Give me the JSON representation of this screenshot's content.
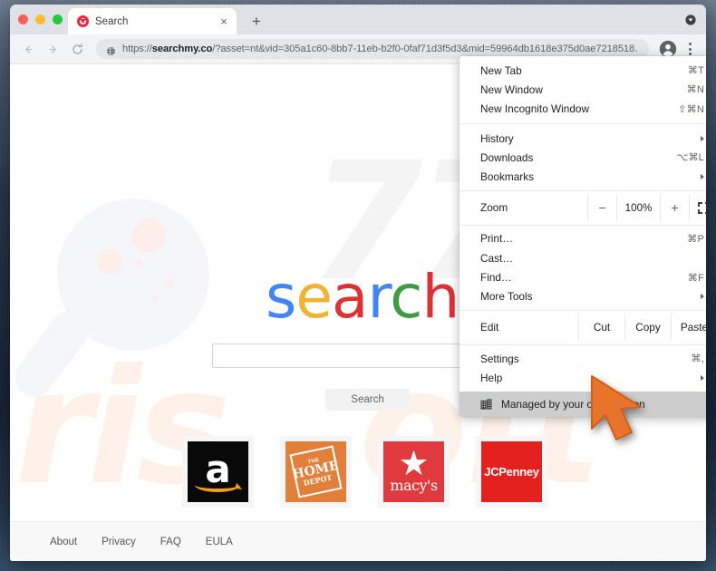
{
  "window": {
    "traffic_lights": [
      "close",
      "minimize",
      "maximize"
    ]
  },
  "tab": {
    "title": "Search",
    "favicon": "search-favicon",
    "close_label": "×",
    "newtab_label": "+"
  },
  "toolbar": {
    "back_icon": "back-arrow-icon",
    "forward_icon": "forward-arrow-icon",
    "reload_icon": "reload-icon",
    "site_icon": "globe-icon",
    "url_scheme": "https://",
    "url_host": "searchmy.co",
    "url_path": "/?asset=nt&vid=305a1c60-8bb7-11eb-b2f0-0faf71d3f5d3&mid=59964db1618e375d0ae7218518…",
    "profile_icon": "profile-avatar-icon",
    "menu_icon": "three-dot-menu-icon"
  },
  "menu": {
    "groups": [
      {
        "items": [
          {
            "label": "New Tab",
            "accel": "⌘T",
            "arrow": false
          },
          {
            "label": "New Window",
            "accel": "⌘N",
            "arrow": false
          },
          {
            "label": "New Incognito Window",
            "accel": "⇧⌘N",
            "arrow": false
          }
        ]
      },
      {
        "items": [
          {
            "label": "History",
            "accel": "",
            "arrow": true
          },
          {
            "label": "Downloads",
            "accel": "⌥⌘L",
            "arrow": false
          },
          {
            "label": "Bookmarks",
            "accel": "",
            "arrow": true
          }
        ]
      }
    ],
    "zoom": {
      "label": "Zoom",
      "minus": "−",
      "value": "100%",
      "plus": "+",
      "fullscreen_icon": "fullscreen-icon"
    },
    "group3": [
      {
        "label": "Print…",
        "accel": "⌘P",
        "arrow": false
      },
      {
        "label": "Cast…",
        "accel": "",
        "arrow": false
      },
      {
        "label": "Find…",
        "accel": "⌘F",
        "arrow": false
      },
      {
        "label": "More Tools",
        "accel": "",
        "arrow": true
      }
    ],
    "edit": {
      "label": "Edit",
      "cut": "Cut",
      "copy": "Copy",
      "paste": "Paste"
    },
    "group4": [
      {
        "label": "Settings",
        "accel": "⌘,",
        "arrow": false
      },
      {
        "label": "Help",
        "accel": "",
        "arrow": true
      }
    ],
    "managed": {
      "icon": "organisation-building-icon",
      "label": "Managed by your organisation"
    }
  },
  "page": {
    "watermark": [
      "77",
      "ris",
      "oft"
    ],
    "logo": [
      {
        "char": "s",
        "color": "#4285f4"
      },
      {
        "char": "e",
        "color": "#f2b233"
      },
      {
        "char": "a",
        "color": "#db3236"
      },
      {
        "char": "r",
        "color": "#4285f4"
      },
      {
        "char": "c",
        "color": "#3f9c45"
      },
      {
        "char": "h",
        "color": "#db3236"
      }
    ],
    "search_input_value": "",
    "search_input_placeholder": "",
    "search_button": "Search",
    "magnifier_icon": "magnifying-glass-illustration",
    "tiles": [
      {
        "name": "Amazon",
        "mark": "a"
      },
      {
        "name": "The Home Depot",
        "line1": "THE",
        "line2": "HOME",
        "line3": "DEPOT"
      },
      {
        "name": "Macy's",
        "star": "★",
        "word": "macy's"
      },
      {
        "name": "JCPenney",
        "word": "JCPenney"
      }
    ],
    "footer_links": [
      "About",
      "Privacy",
      "FAQ",
      "EULA"
    ]
  },
  "cursor": {
    "icon": "orange-arrow-cursor"
  }
}
